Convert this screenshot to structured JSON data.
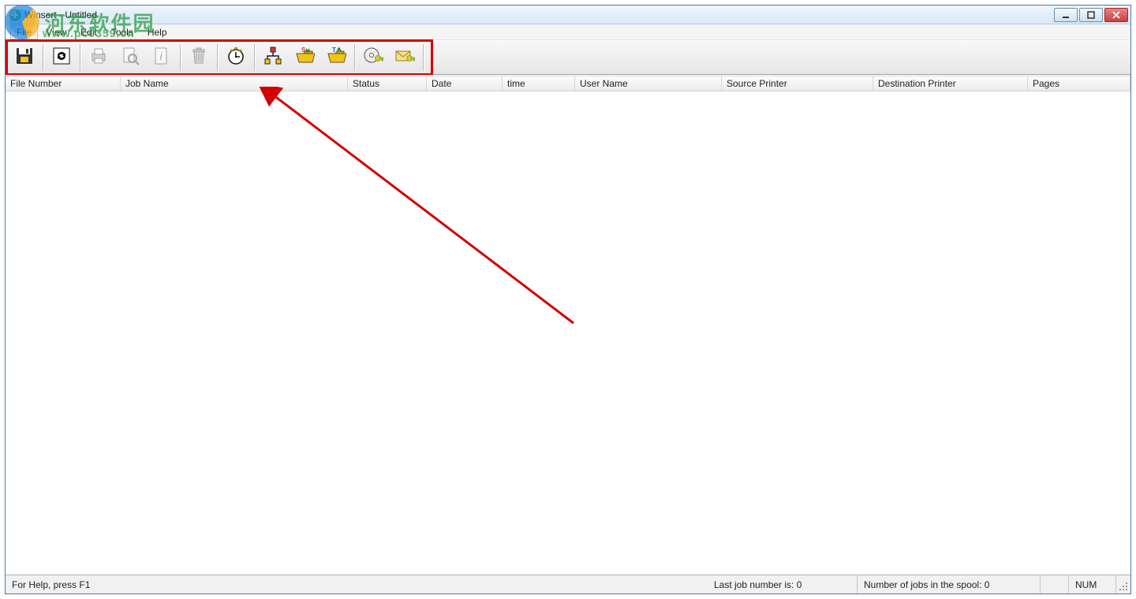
{
  "watermark": {
    "text1": "河东软件园",
    "text2": "www.pc0359.cn"
  },
  "window": {
    "title": "Winsert - Untitled"
  },
  "menu": {
    "file": "File",
    "view": "View",
    "edit": "Edit",
    "tools": "Tools",
    "help": "Help"
  },
  "toolbar": {
    "save": "save-icon",
    "refresh": "refresh-icon",
    "print": "print-icon",
    "preview": "preview-icon",
    "info": "info-icon",
    "delete": "delete-icon",
    "clock": "clock-icon",
    "tree": "tree-icon",
    "open1": "open-folder-sc-icon",
    "open2": "open-folder-tx-icon",
    "key1": "disc-key-icon",
    "key2": "envelope-key-icon"
  },
  "columns": {
    "fileNumber": "File Number",
    "jobName": "Job Name",
    "status": "Status",
    "date": "Date",
    "time": "time",
    "userName": "User Name",
    "sourcePrinter": "Source Printer",
    "destPrinter": "Destination Printer",
    "pages": "Pages"
  },
  "rows": [],
  "status": {
    "help": "For Help, press F1",
    "lastJob": "Last job number is: 0",
    "spoolJobs": "Number of jobs in the spool: 0",
    "num": "NUM"
  }
}
